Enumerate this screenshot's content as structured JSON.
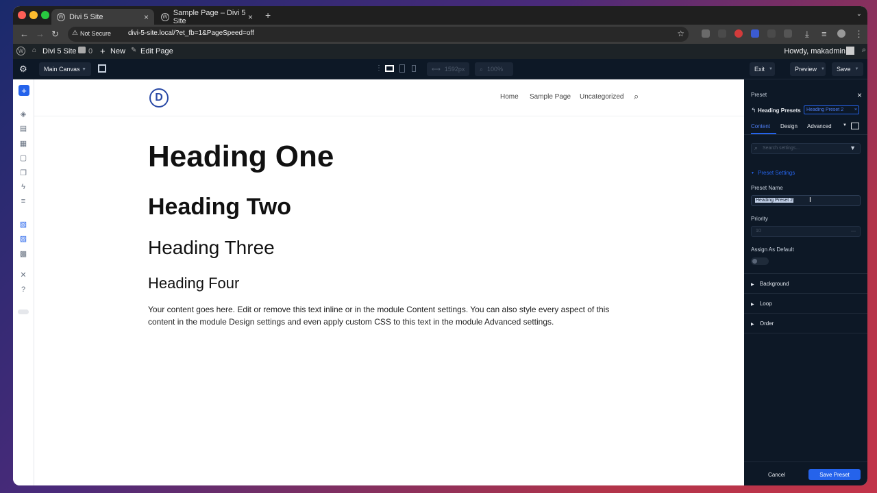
{
  "browser": {
    "tabs": [
      {
        "label": "Divi 5 Site"
      },
      {
        "label": "Sample Page – Divi 5 Site"
      }
    ],
    "new_tab": "+",
    "url_security": "Not Secure",
    "url": "divi-5-site.local/?et_fb=1&PageSpeed=off"
  },
  "wp_admin_bar": {
    "site_name": "Divi 5 Site",
    "comments_count": "0",
    "new_label": "New",
    "edit_page_label": "Edit Page",
    "howdy": "Howdy, makadmin"
  },
  "builder_toolbar": {
    "canvas_label": "Main Canvas",
    "width_value": "1592px",
    "zoom_value": "100%",
    "exit_label": "Exit",
    "preview_label": "Preview",
    "save_label": "Save"
  },
  "site": {
    "logo_letter": "D",
    "menu": [
      "Home",
      "Sample Page",
      "Uncategorized"
    ]
  },
  "content": {
    "heading_one": "Heading One",
    "heading_two": "Heading Two",
    "heading_three": "Heading Three",
    "heading_four": "Heading Four",
    "body": "Your content goes here. Edit or remove this text inline or in the module Content settings. You can also style every aspect of this content in the module Design settings and even apply custom CSS to this text in the module Advanced settings."
  },
  "preset_panel": {
    "title": "Preset",
    "breadcrumb": "Heading Presets",
    "preset_chip": "Heading Preset 2",
    "tabs": [
      "Content",
      "Design",
      "Advanced"
    ],
    "search_placeholder": "Search settings...",
    "section_title": "Preset Settings",
    "preset_name_label": "Preset Name",
    "preset_name_value": "Heading Preset 2",
    "priority_label": "Priority",
    "priority_value": "10",
    "priority_suffix": "—",
    "assign_default_label": "Assign As Default",
    "collapsed_sections": [
      "Background",
      "Loop",
      "Order"
    ],
    "cancel_label": "Cancel",
    "save_preset_label": "Save Preset"
  },
  "colors": {
    "accent": "#2563eb",
    "panel_bg": "#0d1826"
  }
}
